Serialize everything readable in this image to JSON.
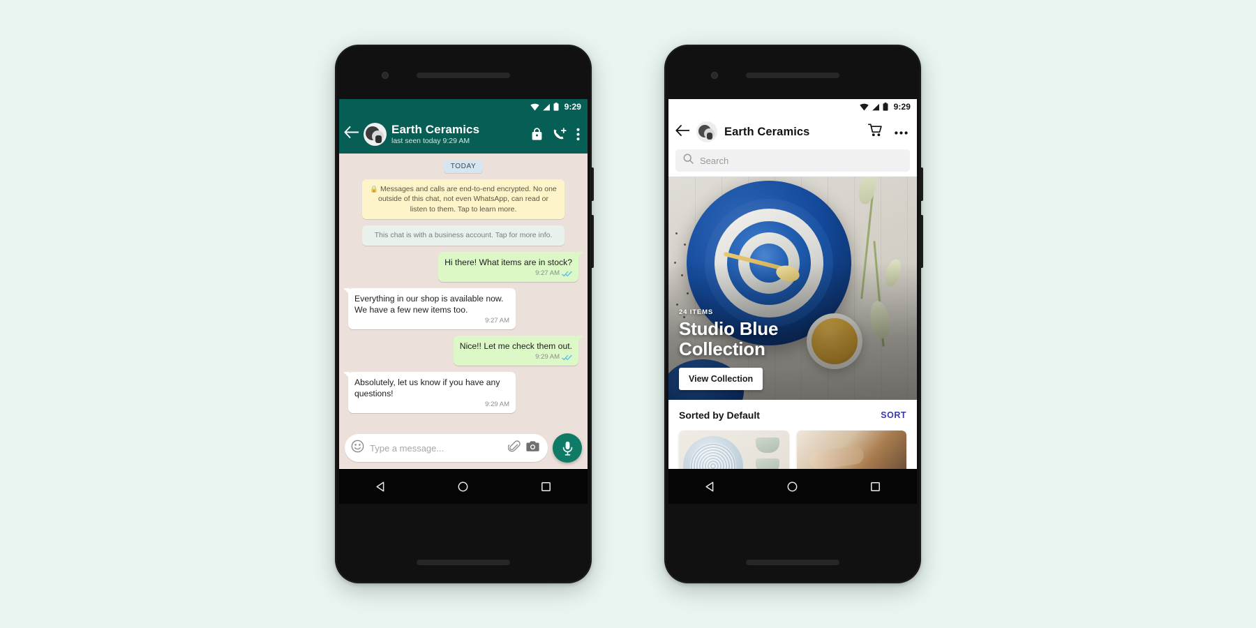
{
  "page": {
    "background_color": "#e8f5f0",
    "accent_whatsapp_green": "#075e54",
    "accent_bubble_out": "#dcf8c6",
    "accent_sort_link": "#3b3ba6"
  },
  "chat_phone": {
    "status_bar": {
      "time": "9:29",
      "icons": [
        "wifi-icon",
        "signal-icon",
        "battery-icon"
      ]
    },
    "header": {
      "back_icon": "arrow-left-icon",
      "avatar": "contact-avatar",
      "title": "Earth Ceramics",
      "subtitle": "last seen today 9:29 AM",
      "actions": [
        {
          "name": "shop-icon",
          "label": "Shop"
        },
        {
          "name": "video-call-icon",
          "label": "Video call"
        },
        {
          "name": "overflow-menu-icon",
          "label": "More options"
        }
      ]
    },
    "day_divider": "TODAY",
    "notices": [
      {
        "type": "encryption",
        "icon": "lock-icon",
        "text": "Messages and calls are end-to-end encrypted. No one outside of this chat, not even WhatsApp, can read or listen to them. Tap to learn more."
      },
      {
        "type": "business",
        "text": "This chat is with a business account. Tap for more info."
      }
    ],
    "messages": [
      {
        "direction": "out",
        "text": "Hi there! What items are in stock?",
        "time": "9:27 AM",
        "status": "read"
      },
      {
        "direction": "in",
        "text": "Everything in our shop is available now. We have a few new items too.",
        "time": "9:27 AM",
        "status": ""
      },
      {
        "direction": "out",
        "text": "Nice!! Let me check them out.",
        "time": "9:29 AM",
        "status": "read"
      },
      {
        "direction": "in",
        "text": "Absolutely, let us know if you have any questions!",
        "time": "9:29 AM",
        "status": ""
      }
    ],
    "composer": {
      "emoji_icon": "emoji-icon",
      "placeholder": "Type a message...",
      "attach_icon": "paperclip-icon",
      "camera_icon": "camera-icon",
      "mic_icon": "microphone-icon"
    },
    "nav_bar": [
      "back-triangle-icon",
      "home-circle-icon",
      "recents-square-icon"
    ]
  },
  "catalog_phone": {
    "status_bar": {
      "time": "9:29",
      "icons": [
        "wifi-icon",
        "signal-icon",
        "battery-icon"
      ]
    },
    "header": {
      "back_icon": "arrow-left-icon",
      "avatar": "business-avatar",
      "title": "Earth Ceramics",
      "actions": [
        {
          "name": "cart-icon",
          "label": "Cart"
        },
        {
          "name": "overflow-menu-icon",
          "label": "More options"
        }
      ]
    },
    "search": {
      "icon": "search-icon",
      "placeholder": "Search",
      "value": ""
    },
    "hero": {
      "kicker": "24 ITEMS",
      "title": "Studio Blue Collection",
      "button_label": "View Collection"
    },
    "sort": {
      "label": "Sorted by Default",
      "action_label": "SORT"
    },
    "products": [
      {
        "name": "blue-bowl-and-cups-thumbnail"
      },
      {
        "name": "potter-at-work-thumbnail"
      }
    ],
    "nav_bar": [
      "back-triangle-icon",
      "home-circle-icon",
      "recents-square-icon"
    ]
  }
}
